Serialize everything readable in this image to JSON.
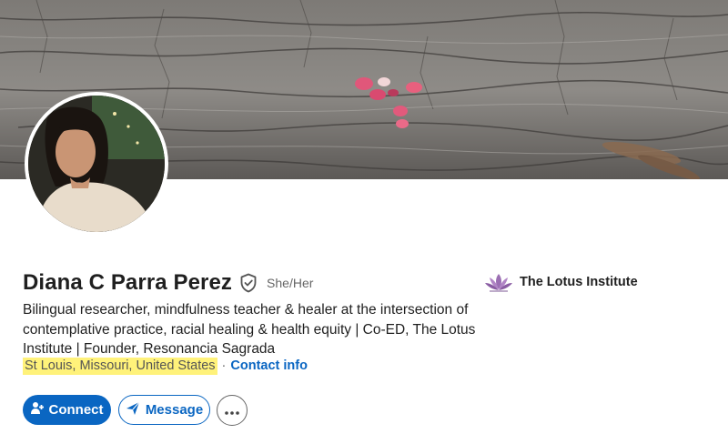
{
  "profile": {
    "name": "Diana C Parra Perez",
    "pronouns": "She/Her",
    "headline": "Bilingual researcher, mindfulness teacher & healer at the intersection of contemplative practice, racial healing & health equity | Co-ED, The Lotus Institute | Founder, Resonancia Sagrada",
    "location": "St Louis, Missouri, United States",
    "separator": "·",
    "contact_link": "Contact info"
  },
  "organization": {
    "name": "The Lotus Institute",
    "logo": "lotus-logo"
  },
  "actions": {
    "connect_label": "Connect",
    "message_label": "Message",
    "more_label": "More actions"
  },
  "icons": {
    "verified": "shield-check-icon",
    "connect": "add-person-icon",
    "message": "send-icon",
    "more": "ellipsis-icon"
  },
  "colors": {
    "brand": "#0a66c2",
    "highlight": "#fff27a"
  }
}
